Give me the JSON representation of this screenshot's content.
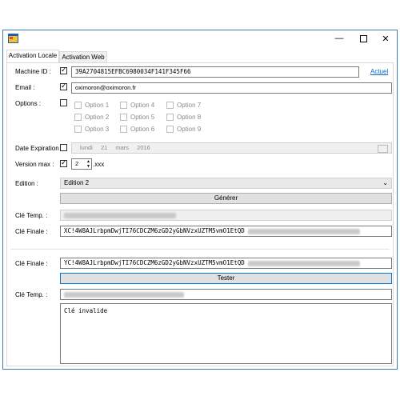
{
  "tabs": [
    "Activation Locale",
    "Activation Web"
  ],
  "labels": {
    "machine_id": "Machine ID :",
    "email": "Email :",
    "options": "Options :",
    "date_expiration": "Date Expiration :",
    "version_max": "Version max :",
    "edition": "Edition :",
    "cle_temp": "Clé Temp. :",
    "cle_finale": "Clé Finale :",
    "cle_finale2": "Clé Finale :",
    "cle_temp2": "Clé Temp. :"
  },
  "fields": {
    "machine_id": "39A2704815EFBC6980034F141F345F66",
    "email": "oximoron@oximoron.fr",
    "cle_finale": "XC!4W8AJLrbpmDwjTI76CDCZM6zGD2yGbNVzxUZTM5vmO1EtQD",
    "cle_finale2": "YC!4W8AJLrbpmDwjTI76CDCZM6zGD2yGbNVzxUZTM5vmO1EtQD",
    "result": "Clé invalide"
  },
  "actuel_link": "Actuel",
  "options_list": [
    "Option 1",
    "Option 2",
    "Option 3",
    "Option 4",
    "Option 5",
    "Option 6",
    "Option 7",
    "Option 8",
    "Option 9"
  ],
  "date": {
    "weekday": "lundi",
    "day": "21",
    "month": "mars",
    "year": "2016"
  },
  "version": {
    "value": "2",
    "suffix": ".xxx"
  },
  "edition": {
    "selected": "Edition 2"
  },
  "buttons": {
    "generer": "Générer",
    "tester": "Tester"
  },
  "icons": [
    "app-icon",
    "minimize-icon",
    "maximize-icon",
    "close-icon",
    "checkmark-icon",
    "calendar-icon",
    "spin-up-icon",
    "spin-down-icon",
    "chevron-down-icon"
  ]
}
